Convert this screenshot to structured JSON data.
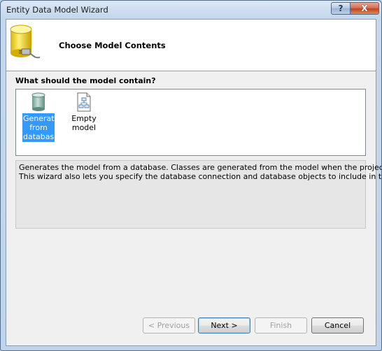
{
  "window": {
    "title": "Entity Data Model Wizard",
    "help_glyph": "?",
    "close_glyph": "X"
  },
  "header": {
    "title": "Choose Model Contents",
    "icon": "database-plug-icon"
  },
  "section": {
    "label": "What should the model contain?"
  },
  "options": [
    {
      "label_lines": [
        "Generate",
        "from",
        "database"
      ],
      "icon": "database-icon",
      "selected": true
    },
    {
      "label": "Empty model",
      "icon": "empty-model-icon",
      "selected": false
    }
  ],
  "description": {
    "line1": "Generates the model from a database. Classes are generated from the model when the project is compiled.",
    "line2": "This wizard also lets you specify the database connection and database objects to include in the model."
  },
  "buttons": {
    "previous": "< Previous",
    "next": "Next >",
    "finish": "Finish",
    "cancel": "Cancel"
  },
  "colors": {
    "selection": "#3399ff",
    "close": "#c2441d"
  }
}
